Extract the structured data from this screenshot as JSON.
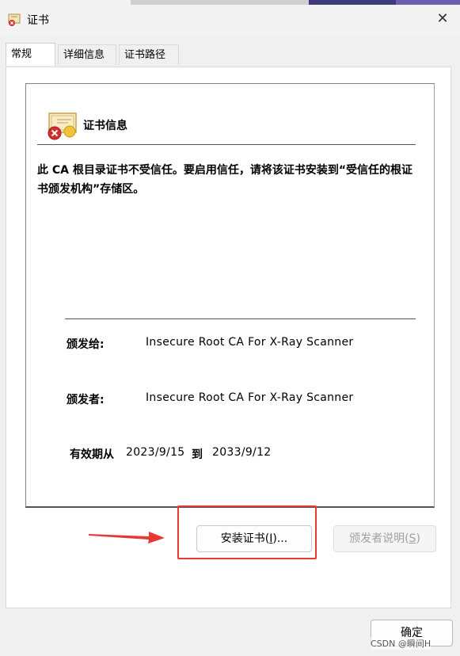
{
  "window": {
    "title": "证书",
    "close_icon": "close-icon",
    "title_icon": "certificate-error-icon"
  },
  "tabs": [
    {
      "label": "常规",
      "active": true
    },
    {
      "label": "详细信息",
      "active": false
    },
    {
      "label": "证书路径",
      "active": false
    }
  ],
  "cert": {
    "header": "证书信息",
    "icon": "certificate-error-icon",
    "warning": "此 CA 根目录证书不受信任。要启用信任，请将该证书安装到“受信任的根证书颁发机构”存储区。",
    "issued_to_label": "颁发给:",
    "issued_to_value": "Insecure Root CA For X-Ray Scanner",
    "issued_by_label": "颁发者:",
    "issued_by_value": "Insecure Root CA For X-Ray Scanner",
    "validity_label": "有效期从",
    "valid_from": "2023/9/15",
    "validity_to_label": "到",
    "valid_to": "2033/9/12"
  },
  "buttons": {
    "install_label": "安装证书(",
    "install_mnemonic": "I",
    "install_suffix": ")...",
    "issuer_statement_label": "颁发者说明(",
    "issuer_statement_mnemonic": "S",
    "issuer_statement_suffix": ")",
    "ok_label": "确定"
  },
  "annotation": {
    "highlight_color": "#e53935",
    "arrow_color": "#e53935"
  },
  "watermark": "CSDN @瞬间H"
}
